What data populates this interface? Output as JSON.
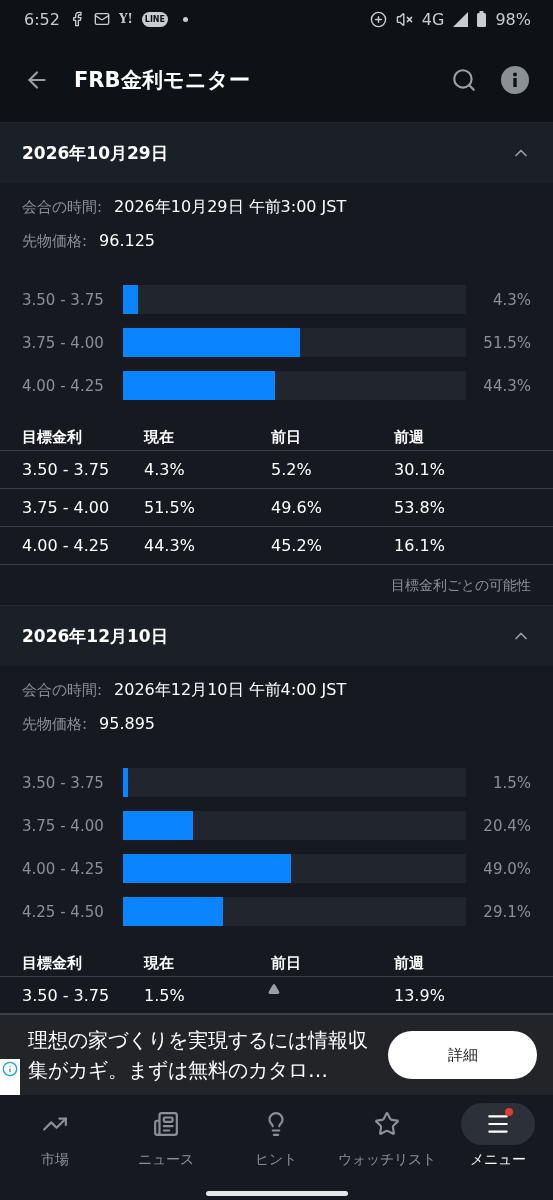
{
  "status_bar": {
    "time": "6:52",
    "notifications": [
      {
        "kind": "facebook"
      },
      {
        "kind": "mail"
      },
      {
        "kind": "text",
        "label": "Y!"
      },
      {
        "kind": "badge",
        "label": "LINE"
      },
      {
        "kind": "dot"
      }
    ],
    "network": "4G",
    "battery": "98%"
  },
  "app_bar": {
    "title": "FRB金利モニター"
  },
  "meetings": [
    {
      "date": "2026年10月29日",
      "expanded": true,
      "time_label": "会合の時間:",
      "time": "2026年10月29日 午前3:00 JST",
      "price_label": "先物価格:",
      "price": "96.125",
      "bars": [
        {
          "range": "3.50 - 3.75",
          "level": 0.043,
          "percent": "4.3%"
        },
        {
          "range": "3.75 - 4.00",
          "level": 0.515,
          "percent": "51.5%"
        },
        {
          "range": "4.00 - 4.25",
          "level": 0.443,
          "percent": "44.3%"
        }
      ],
      "table": {
        "columns": [
          "目標金利",
          "現在",
          "前日",
          "前週"
        ],
        "rows": [
          [
            "3.50 - 3.75",
            "4.3%",
            "5.2%",
            "30.1%"
          ],
          [
            "3.75 - 4.00",
            "51.5%",
            "49.6%",
            "53.8%"
          ],
          [
            "4.00 - 4.25",
            "44.3%",
            "45.2%",
            "16.1%"
          ]
        ]
      },
      "footnote": "目標金利ごとの可能性"
    },
    {
      "date": "2026年12月10日",
      "expanded": true,
      "time_label": "会合の時間:",
      "time": "2026年12月10日 午前4:00 JST",
      "price_label": "先物価格:",
      "price": "95.895",
      "bars": [
        {
          "range": "3.50 - 3.75",
          "level": 0.015,
          "percent": "1.5%"
        },
        {
          "range": "3.75 - 4.00",
          "level": 0.204,
          "percent": "20.4%"
        },
        {
          "range": "4.00 - 4.25",
          "level": 0.49,
          "percent": "49.0%"
        },
        {
          "range": "4.25 - 4.50",
          "level": 0.291,
          "percent": "29.1%"
        }
      ],
      "table": {
        "columns": [
          "目標金利",
          "現在",
          "前日",
          "前週"
        ],
        "rows": [
          [
            "3.50 - 3.75",
            "1.5%",
            null,
            "13.9%"
          ]
        ]
      }
    }
  ],
  "ad": {
    "text": "理想の家づくりを実現するには情報収集がカギ。まずは無料のカタロ…",
    "button": "詳細"
  },
  "bottom_nav": [
    {
      "kind": "markets",
      "label": "市場",
      "selected": false
    },
    {
      "kind": "news",
      "label": "ニュース",
      "selected": false
    },
    {
      "kind": "tips",
      "label": "ヒント",
      "selected": false
    },
    {
      "kind": "watchlist",
      "label": "ウォッチリスト",
      "selected": false
    },
    {
      "kind": "menu",
      "label": "メニュー",
      "selected": true,
      "badge": true
    }
  ]
}
